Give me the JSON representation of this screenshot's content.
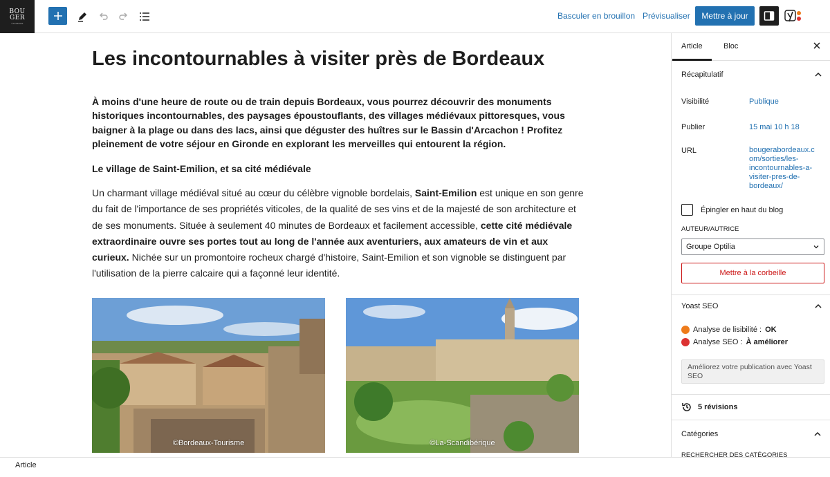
{
  "brand": {
    "logo_lines": [
      "BOU",
      "GER"
    ],
    "logo_small": "à bordeaux"
  },
  "toolbar": {
    "switch_draft": "Basculer en brouillon",
    "preview": "Prévisualiser",
    "update": "Mettre à jour",
    "icons": [
      "plus-icon",
      "pen-icon",
      "undo-icon",
      "redo-icon",
      "list-view-icon",
      "settings-icon",
      "yoast-icon"
    ],
    "accent": "#2271b1"
  },
  "post": {
    "title": "Les incontournables à visiter près de Bordeaux",
    "intro": "À moins d'une heure de route ou de train depuis Bordeaux, vous pourrez découvrir des monuments historiques incontournables, des paysages époustouflants, des villages médiévaux pittoresques, vous baigner à la plage ou dans des lacs, ainsi que déguster des huîtres sur le Bassin d'Arcachon ! Profitez pleinement de votre séjour en Gironde en explorant les merveilles qui entourent la région.",
    "subheading": "Le village de Saint-Emilion, et sa cité médiévale",
    "para_1": "Un charmant village médiéval situé au cœur du célèbre vignoble bordelais, ",
    "para_b1": "Saint-Emilion",
    "para_2": " est unique en son genre du fait de l'importance de ses propriétés viticoles, de la qualité de ses vins et de la majesté de son architecture et de ses monuments. Située à seulement 40 minutes de Bordeaux et facilement accessible, ",
    "para_b2": "cette cité médiévale extraordinaire ouvre ses portes tout au long de l'année aux aventuriers, aux amateurs de vin et aux curieux.",
    "para_3": " Nichée sur un promontoire rocheux chargé d'histoire, Saint-Emilion et son vignoble se distinguent par l'utilisation de la pierre calcaire qui a façonné leur identité.",
    "images": [
      {
        "caption": "©Bordeaux-Tourisme"
      },
      {
        "caption": "©La-Scandibérique"
      }
    ]
  },
  "sidebar": {
    "tabs": [
      "Article",
      "Bloc"
    ],
    "summary": {
      "title": "Récapitulatif",
      "visibility_label": "Visibilité",
      "visibility_value": "Publique",
      "published_label": "Publier",
      "published_value": "15 mai 10 h 18",
      "url_label": "URL",
      "url_value": "bougerabordeaux.com/sorties/les-incontournables-a-visiter-pres-de-bordeaux/",
      "url_lines": [
        "bougerabordeaux.c",
        "om/sorties/les-",
        "incontournables-a-",
        "visiter-pres-de-",
        "bordeaux/"
      ],
      "sticky_label": "Épingler en haut du blog",
      "author_label": "AUTEUR/AUTRICE",
      "author_value": "Groupe Optilia",
      "trash": "Mettre à la corbeille"
    },
    "yoast": {
      "title": "Yoast SEO",
      "readability_label": "Analyse de lisibilité : ",
      "readability_value": "OK",
      "seo_label": "Analyse SEO : ",
      "seo_value": "À améliorer",
      "readability_color": "#ee7c1b",
      "seo_color": "#dc3232",
      "promo": "Améliorez votre publication avec Yoast SEO"
    },
    "revisions": "5 révisions",
    "categories": {
      "title": "Catégories",
      "search_label": "RECHERCHER DES CATÉGORIES"
    }
  },
  "status": {
    "breadcrumb": "Article"
  }
}
